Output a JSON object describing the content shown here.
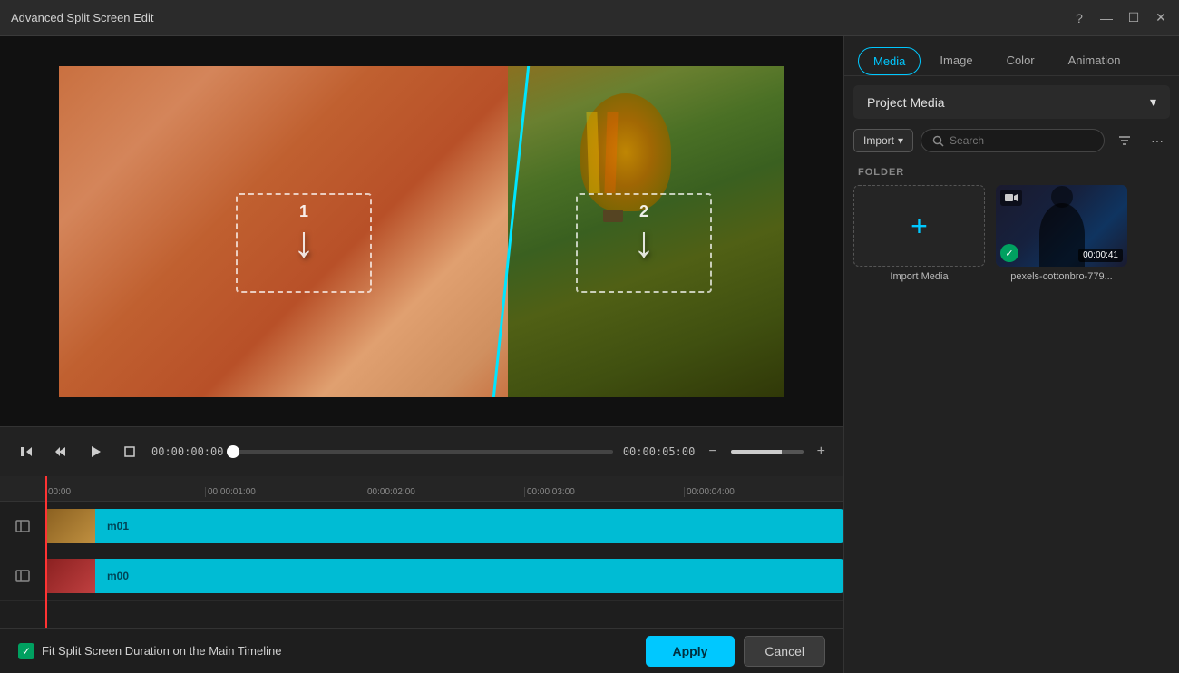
{
  "titleBar": {
    "title": "Advanced Split Screen Edit",
    "controls": {
      "help": "?",
      "minimize": "—",
      "maximize": "☐",
      "close": "✕"
    }
  },
  "preview": {
    "dropZone1": {
      "number": "1",
      "arrow": "↓"
    },
    "dropZone2": {
      "number": "2",
      "arrow": "↓"
    }
  },
  "playback": {
    "timeStart": "00:00:00:00",
    "timeEnd": "00:00:05:00"
  },
  "timeline": {
    "tracks": [
      {
        "label": "m01"
      },
      {
        "label": "m00"
      }
    ],
    "rulers": [
      "00:00",
      "00:00:01:00",
      "00:00:02:00",
      "00:00:03:00",
      "00:00:04:00"
    ]
  },
  "bottomBar": {
    "fitLabel": "Fit Split Screen Duration on the Main Timeline",
    "applyLabel": "Apply",
    "cancelLabel": "Cancel"
  },
  "rightPanel": {
    "tabs": [
      {
        "label": "Media",
        "active": true
      },
      {
        "label": "Image",
        "active": false
      },
      {
        "label": "Color",
        "active": false
      },
      {
        "label": "Animation",
        "active": false
      }
    ],
    "dropdown": {
      "label": "Project Media",
      "chevron": "▾"
    },
    "toolbar": {
      "importLabel": "Import",
      "importChevron": "▾",
      "searchPlaceholder": "Search",
      "filterIcon": "filter",
      "moreIcon": "···"
    },
    "folderLabel": "FOLDER",
    "mediaItems": [
      {
        "type": "import",
        "name": "Import Media"
      },
      {
        "type": "video",
        "name": "pexels-cottonbro-779...",
        "duration": "00:00:41",
        "hasCheck": true
      }
    ]
  }
}
